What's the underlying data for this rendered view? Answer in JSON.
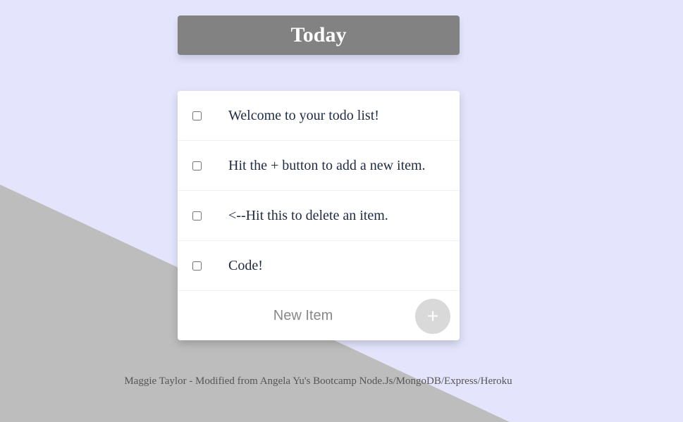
{
  "colors": {
    "background": "#e4e5fd",
    "diagonal_shape": "#bdbdbd",
    "heading_bg": "#828282",
    "card_bg": "#ffffff",
    "add_button_bg": "#d9d9d9"
  },
  "heading": {
    "title": "Today"
  },
  "todo": {
    "items": [
      {
        "label": "Welcome to your todo list!",
        "checked": false
      },
      {
        "label": "Hit the + button to add a new item.",
        "checked": false
      },
      {
        "label": "<--Hit this to delete an item.",
        "checked": false
      },
      {
        "label": "Code!",
        "checked": false
      }
    ],
    "new_item": {
      "placeholder": "New Item",
      "value": ""
    },
    "add_button_label": "+"
  },
  "footer": {
    "text": "Maggie Taylor - Modified from Angela Yu's Bootcamp Node.Js/MongoDB/Express/Heroku"
  }
}
